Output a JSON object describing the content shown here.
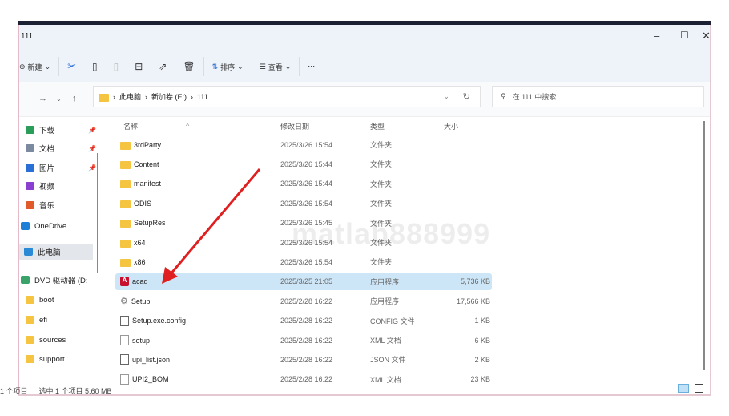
{
  "window": {
    "title": "111",
    "controls": [
      "minimize",
      "maximize",
      "close"
    ]
  },
  "toolbar": {
    "new_label": "新建",
    "sort_label": "排序",
    "view_label": "查看",
    "more_label": "···",
    "icons": [
      "cut-icon",
      "copy-icon",
      "paste-icon",
      "rename-icon",
      "share-icon",
      "delete-icon"
    ]
  },
  "address": {
    "crumbs": [
      "此电脑",
      "新加卷 (E:)",
      "111"
    ],
    "search_placeholder": "在 111 中搜索"
  },
  "sidebar": {
    "items": [
      {
        "label": "下载",
        "icon": "download-icon",
        "pinned": true,
        "color": "#2a9d5a"
      },
      {
        "label": "文档",
        "icon": "document-icon",
        "pinned": true,
        "color": "#7c8aa0"
      },
      {
        "label": "图片",
        "icon": "pictures-icon",
        "pinned": true,
        "color": "#2a6fd6"
      },
      {
        "label": "视频",
        "icon": "video-icon",
        "pinned": false,
        "color": "#8a3fd1"
      },
      {
        "label": "音乐",
        "icon": "music-icon",
        "pinned": false,
        "color": "#e05a2a"
      },
      {
        "label": "OneDrive",
        "icon": "cloud-icon",
        "pinned": false,
        "color": "#1e7fd6"
      },
      {
        "label": "此电脑",
        "icon": "computer-icon",
        "pinned": false,
        "color": "#2a8ad6",
        "selected": true
      },
      {
        "label": "DVD 驱动器 (D:",
        "icon": "dvd-icon",
        "pinned": false,
        "color": "#3aa36a"
      },
      {
        "label": "boot",
        "icon": "folder-icon",
        "pinned": false,
        "color": "#f5c542"
      },
      {
        "label": "efi",
        "icon": "folder-icon",
        "pinned": false,
        "color": "#f5c542"
      },
      {
        "label": "sources",
        "icon": "folder-icon",
        "pinned": false,
        "color": "#f5c542"
      },
      {
        "label": "support",
        "icon": "folder-icon",
        "pinned": false,
        "color": "#f5c542"
      }
    ]
  },
  "columns": {
    "name": "名称",
    "date": "修改日期",
    "type": "类型",
    "size": "大小"
  },
  "files": [
    {
      "name": "3rdParty",
      "date": "2025/3/26 15:54",
      "type": "文件夹",
      "size": "",
      "icon": "folder"
    },
    {
      "name": "Content",
      "date": "2025/3/26 15:44",
      "type": "文件夹",
      "size": "",
      "icon": "folder"
    },
    {
      "name": "manifest",
      "date": "2025/3/26 15:44",
      "type": "文件夹",
      "size": "",
      "icon": "folder"
    },
    {
      "name": "ODIS",
      "date": "2025/3/26 15:54",
      "type": "文件夹",
      "size": "",
      "icon": "folder"
    },
    {
      "name": "SetupRes",
      "date": "2025/3/26 15:45",
      "type": "文件夹",
      "size": "",
      "icon": "folder"
    },
    {
      "name": "x64",
      "date": "2025/3/26 15:54",
      "type": "文件夹",
      "size": "",
      "icon": "folder"
    },
    {
      "name": "x86",
      "date": "2025/3/26 15:54",
      "type": "文件夹",
      "size": "",
      "icon": "folder"
    },
    {
      "name": "acad",
      "date": "2025/3/25 21:05",
      "type": "应用程序",
      "size": "5,736 KB",
      "icon": "autocad",
      "selected": true
    },
    {
      "name": "Setup",
      "date": "2025/2/28 16:22",
      "type": "应用程序",
      "size": "17,566 KB",
      "icon": "setup"
    },
    {
      "name": "Setup.exe.config",
      "date": "2025/2/28 16:22",
      "type": "CONFIG 文件",
      "size": "1 KB",
      "icon": "file"
    },
    {
      "name": "setup",
      "date": "2025/2/28 16:22",
      "type": "XML 文档",
      "size": "6 KB",
      "icon": "xml"
    },
    {
      "name": "upi_list.json",
      "date": "2025/2/28 16:22",
      "type": "JSON 文件",
      "size": "2 KB",
      "icon": "file"
    },
    {
      "name": "UPI2_BOM",
      "date": "2025/2/28 16:22",
      "type": "XML 文档",
      "size": "23 KB",
      "icon": "xml"
    }
  ],
  "status": {
    "count": "1 个项目",
    "selection": "选中 1 个项目 5.60 MB"
  },
  "watermark": "matlab888999",
  "annotation": {
    "arrow_color": "#e02020"
  }
}
